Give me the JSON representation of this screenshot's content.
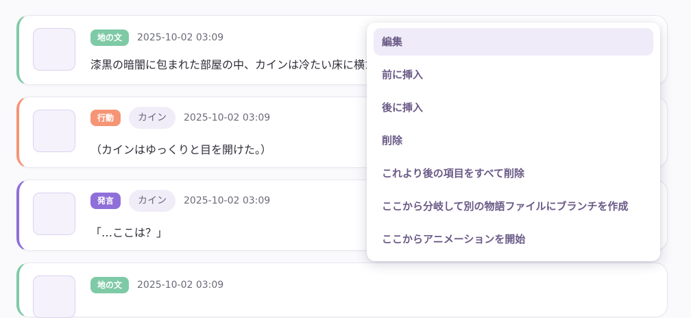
{
  "cards": [
    {
      "type": "地の文",
      "character": "",
      "time": "2025-10-02 03:09",
      "text": "漆黒の暗闇に包まれた部屋の中、カインは冷たい床に横たわっていた。"
    },
    {
      "type": "行動",
      "character": "カイン",
      "time": "2025-10-02 03:09",
      "text": "（カインはゆっくりと目を開けた。）"
    },
    {
      "type": "発言",
      "character": "カイン",
      "time": "2025-10-02 03:09",
      "text": "「…ここは？」"
    },
    {
      "type": "地の文",
      "character": "",
      "time": "2025-10-02 03:09",
      "text": ""
    }
  ],
  "context_menu": {
    "items": [
      "編集",
      "前に挿入",
      "後に挿入",
      "削除",
      "これより後の項目をすべて削除",
      "ここから分岐して別の物語ファイルにブランチを作成",
      "ここからアニメーションを開始"
    ],
    "active_index": 0
  },
  "colors": {
    "narrative": "#7fcaa6",
    "action": "#f59575",
    "speech": "#8f6fd9",
    "menu_text": "#6a5a86"
  }
}
